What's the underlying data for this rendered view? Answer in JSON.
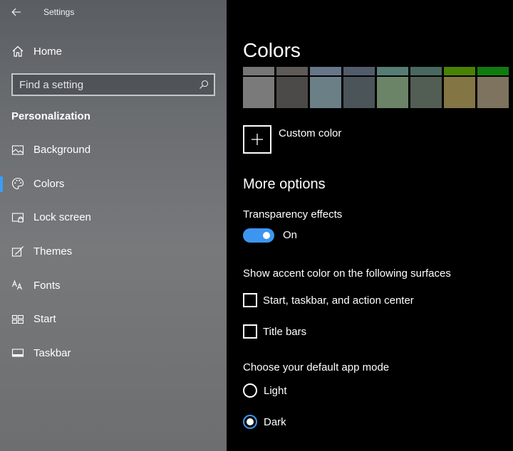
{
  "window": {
    "title": "Settings"
  },
  "sidebar": {
    "home_label": "Home",
    "search_placeholder": "Find a setting",
    "section_title": "Personalization",
    "items": [
      {
        "label": "Background",
        "icon": "picture-icon",
        "active": false
      },
      {
        "label": "Colors",
        "icon": "palette-icon",
        "active": true
      },
      {
        "label": "Lock screen",
        "icon": "lock-screen-icon",
        "active": false
      },
      {
        "label": "Themes",
        "icon": "brush-icon",
        "active": false
      },
      {
        "label": "Fonts",
        "icon": "font-icon",
        "active": false
      },
      {
        "label": "Start",
        "icon": "start-grid-icon",
        "active": false
      },
      {
        "label": "Taskbar",
        "icon": "taskbar-icon",
        "active": false
      }
    ]
  },
  "main": {
    "title": "Colors",
    "swatches_top": [
      "#767676",
      "#5d5a58",
      "#68768a",
      "#515c6b",
      "#567c73",
      "#486860",
      "#498205",
      "#107c10"
    ],
    "swatches_bottom": [
      "#7a7a7a",
      "#4c4a48",
      "#6b7f87",
      "#4a5459",
      "#6b8468",
      "#525e54",
      "#847545",
      "#7e735f"
    ],
    "custom_color_label": "Custom color",
    "more_options_heading": "More options",
    "transparency_label": "Transparency effects",
    "transparency_state": "On",
    "accent_surfaces_label": "Show accent color on the following surfaces",
    "check_start_label": "Start, taskbar, and action center",
    "check_titlebars_label": "Title bars",
    "app_mode_label": "Choose your default app mode",
    "radio_light_label": "Light",
    "radio_dark_label": "Dark",
    "selected_mode": "Dark"
  },
  "colors": {
    "accent": "#3c96f0",
    "indicator": "#3a9df7"
  }
}
